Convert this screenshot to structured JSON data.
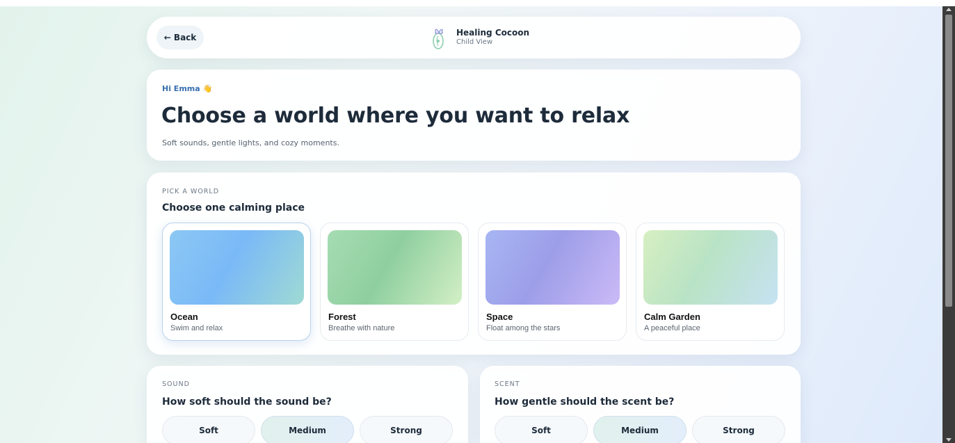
{
  "header": {
    "back_label": "← Back",
    "brand_title": "Healing Cocoon",
    "brand_sub": "Child View"
  },
  "hero": {
    "greeting": "Hi Emma 👋",
    "title": "Choose a world where you want to relax",
    "subtitle": "Soft sounds, gentle lights, and cozy moments."
  },
  "worlds": {
    "eyebrow": "PICK A WORLD",
    "title": "Choose one calming place",
    "selected": "Ocean",
    "items": [
      {
        "name": "Ocean",
        "desc": "Swim and relax",
        "colors": [
          "#8cc8f4",
          "#7ab9f7",
          "#9fdad4"
        ]
      },
      {
        "name": "Forest",
        "desc": "Breathe with nature",
        "colors": [
          "#a6dcb3",
          "#8fcf9f",
          "#d3efc6"
        ]
      },
      {
        "name": "Space",
        "desc": "Float among the stars",
        "colors": [
          "#a7b6f3",
          "#9d9ee8",
          "#cbbaf7"
        ]
      },
      {
        "name": "Calm Garden",
        "desc": "A peaceful place",
        "colors": [
          "#d7efc1",
          "#b9e3c5",
          "#c6e2f2"
        ]
      }
    ]
  },
  "sound": {
    "eyebrow": "SOUND",
    "title": "How soft should the sound be?",
    "options": [
      "Soft",
      "Medium",
      "Strong"
    ],
    "selected": "Medium"
  },
  "scent": {
    "eyebrow": "SCENT",
    "title": "How gentle should the scent be?",
    "options": [
      "Soft",
      "Medium",
      "Strong"
    ],
    "selected": "Medium"
  }
}
